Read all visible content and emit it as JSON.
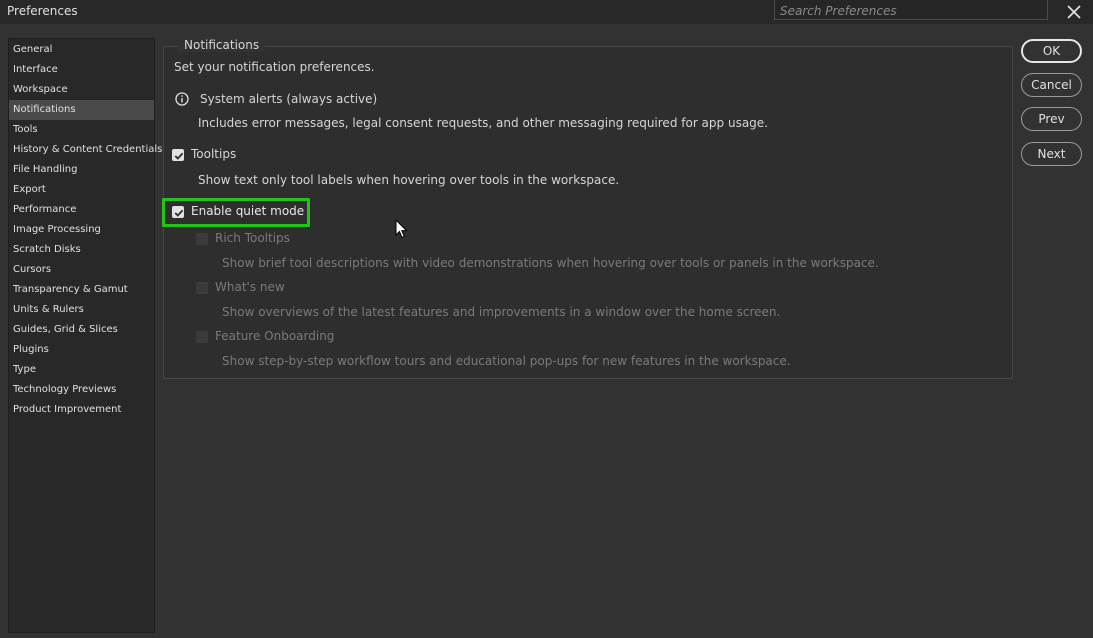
{
  "window": {
    "title": "Preferences"
  },
  "search": {
    "placeholder": "Search Preferences"
  },
  "sidebar": {
    "items": [
      {
        "label": "General"
      },
      {
        "label": "Interface"
      },
      {
        "label": "Workspace"
      },
      {
        "label": "Notifications",
        "selected": true
      },
      {
        "label": "Tools"
      },
      {
        "label": "History & Content Credentials"
      },
      {
        "label": "File Handling"
      },
      {
        "label": "Export"
      },
      {
        "label": "Performance"
      },
      {
        "label": "Image Processing"
      },
      {
        "label": "Scratch Disks"
      },
      {
        "label": "Cursors"
      },
      {
        "label": "Transparency & Gamut"
      },
      {
        "label": "Units & Rulers"
      },
      {
        "label": "Guides, Grid & Slices"
      },
      {
        "label": "Plugins"
      },
      {
        "label": "Type"
      },
      {
        "label": "Technology Previews"
      },
      {
        "label": "Product Improvement"
      }
    ]
  },
  "panel": {
    "legend": "Notifications",
    "intro": "Set your notification preferences.",
    "system_alerts": {
      "label": "System alerts (always active)",
      "description": "Includes error messages, legal consent requests, and other messaging required for app usage."
    },
    "tooltips": {
      "label": "Tooltips",
      "checked": true,
      "description": "Show text only tool labels when hovering over tools in the workspace."
    },
    "quiet_mode": {
      "label": "Enable quiet mode",
      "checked": true
    },
    "rich_tooltips": {
      "label": "Rich Tooltips",
      "checked": false,
      "disabled": true,
      "description": "Show brief tool descriptions with video demonstrations when hovering over tools or panels in the workspace."
    },
    "whats_new": {
      "label": "What's new",
      "checked": false,
      "disabled": true,
      "description": "Show overviews of the latest features and improvements in a window over the home screen."
    },
    "feature_onboarding": {
      "label": "Feature Onboarding",
      "checked": false,
      "disabled": true,
      "description": "Show step-by-step workflow tours and educational pop-ups for new features in the workspace."
    }
  },
  "buttons": {
    "ok": "OK",
    "cancel": "Cancel",
    "prev": "Prev",
    "next": "Next"
  },
  "colors": {
    "highlight": "#22c418",
    "background": "#323232",
    "sidebar_selected": "#4a4a4a"
  }
}
